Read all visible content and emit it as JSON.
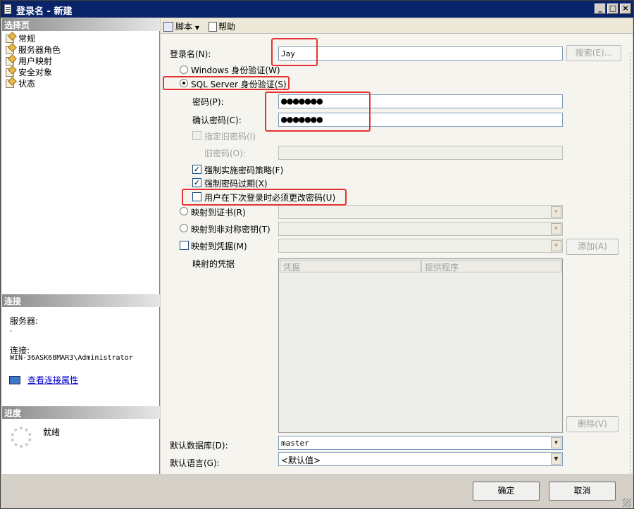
{
  "window": {
    "title": "登录名 - 新建"
  },
  "left": {
    "select_page_header": "选择页",
    "nav": [
      "常规",
      "服务器角色",
      "用户映射",
      "安全对象",
      "状态"
    ],
    "connection_header": "连接",
    "server_label": "服务器:",
    "server_value": ".",
    "connection_label": "连接:",
    "connection_value": "WIN-36ASK68MAR3\\Administrator",
    "view_props_link": "查看连接属性",
    "progress_header": "进度",
    "progress_status": "就绪"
  },
  "toolbar": {
    "script_label": "脚本",
    "help_label": "帮助"
  },
  "form": {
    "login_name_label": "登录名(N):",
    "login_name_value": "Jay",
    "search_button": "搜索(E)...",
    "windows_auth": "Windows 身份验证(W)",
    "sql_auth": "SQL Server 身份验证(S)",
    "password_label": "密码(P):",
    "password_value": "●●●●●●●",
    "confirm_label": "确认密码(C):",
    "confirm_value": "●●●●●●●",
    "specify_old_label": "指定旧密码(I)",
    "old_password_label": "旧密码(O):",
    "enforce_policy_label": "强制实施密码策略(F)",
    "enforce_expiration_label": "强制密码过期(X)",
    "must_change_label": "用户在下次登录时必须更改密码(U)",
    "map_cert_label": "映射到证书(R)",
    "map_asym_label": "映射到非对称密钥(T)",
    "map_cred_label": "映射到凭据(M)",
    "add_button": "添加(A)",
    "mapped_creds_label": "映射的凭据",
    "grid_col_cred": "凭据",
    "grid_col_provider": "提供程序",
    "remove_button": "删除(V)",
    "default_db_label": "默认数据库(D):",
    "default_db_value": "master",
    "default_lang_label": "默认语言(G):",
    "default_lang_value": "<默认值>"
  },
  "footer": {
    "ok": "确定",
    "cancel": "取消"
  }
}
